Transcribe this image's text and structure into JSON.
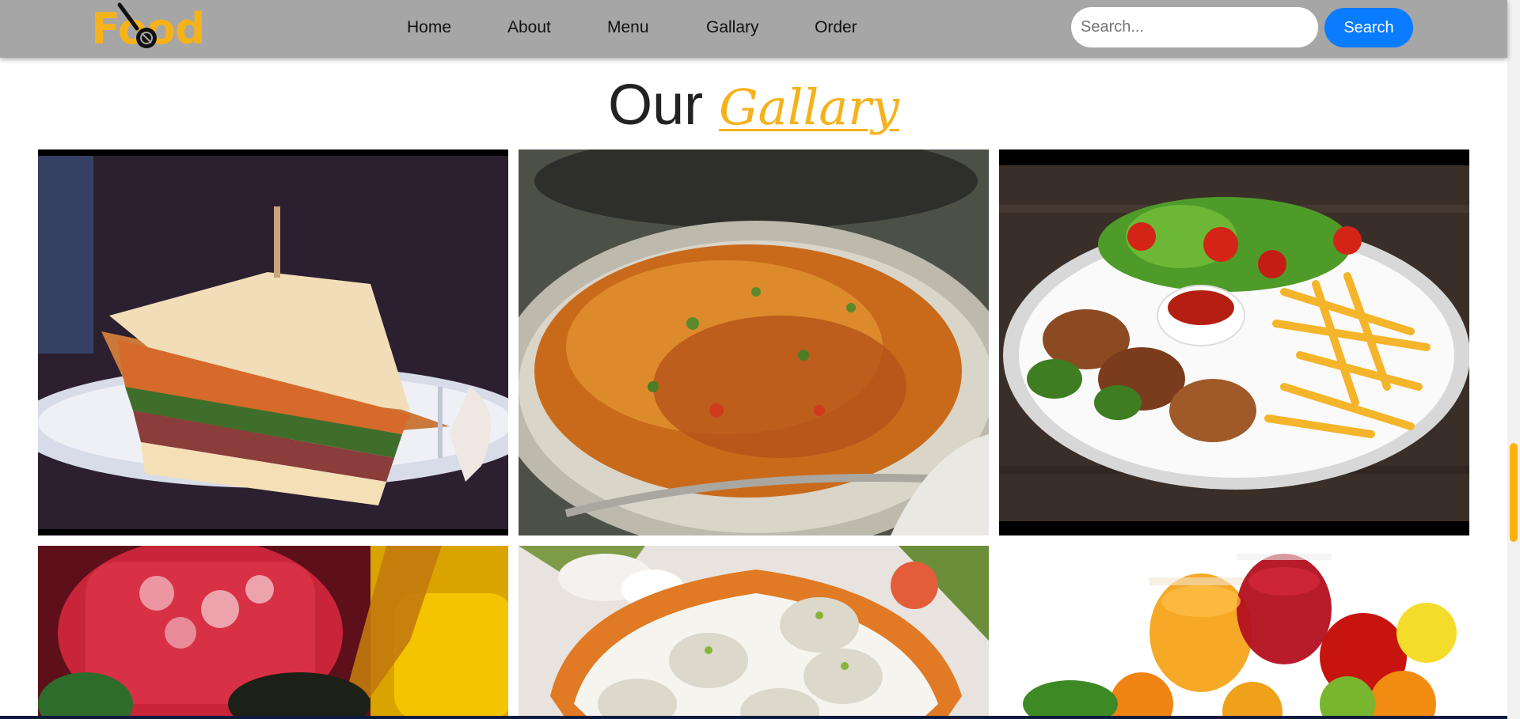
{
  "brand": {
    "logo_text": "Food",
    "accent_color": "#f6b21a"
  },
  "nav": {
    "links": [
      "Home",
      "About",
      "Menu",
      "Gallary",
      "Order"
    ]
  },
  "search": {
    "placeholder": "Search...",
    "value": "",
    "button_label": "Search",
    "button_color": "#0a7cff"
  },
  "heading": {
    "prefix": "Our",
    "accent": "Gallary"
  },
  "gallery": {
    "items": [
      {
        "icon": "sandwich-photo"
      },
      {
        "icon": "biryani-photo"
      },
      {
        "icon": "fried-chicken-fries-photo"
      },
      {
        "icon": "cold-drinks-photo"
      },
      {
        "icon": "sweet-dumplings-photo"
      },
      {
        "icon": "fruit-juice-photo"
      }
    ]
  }
}
